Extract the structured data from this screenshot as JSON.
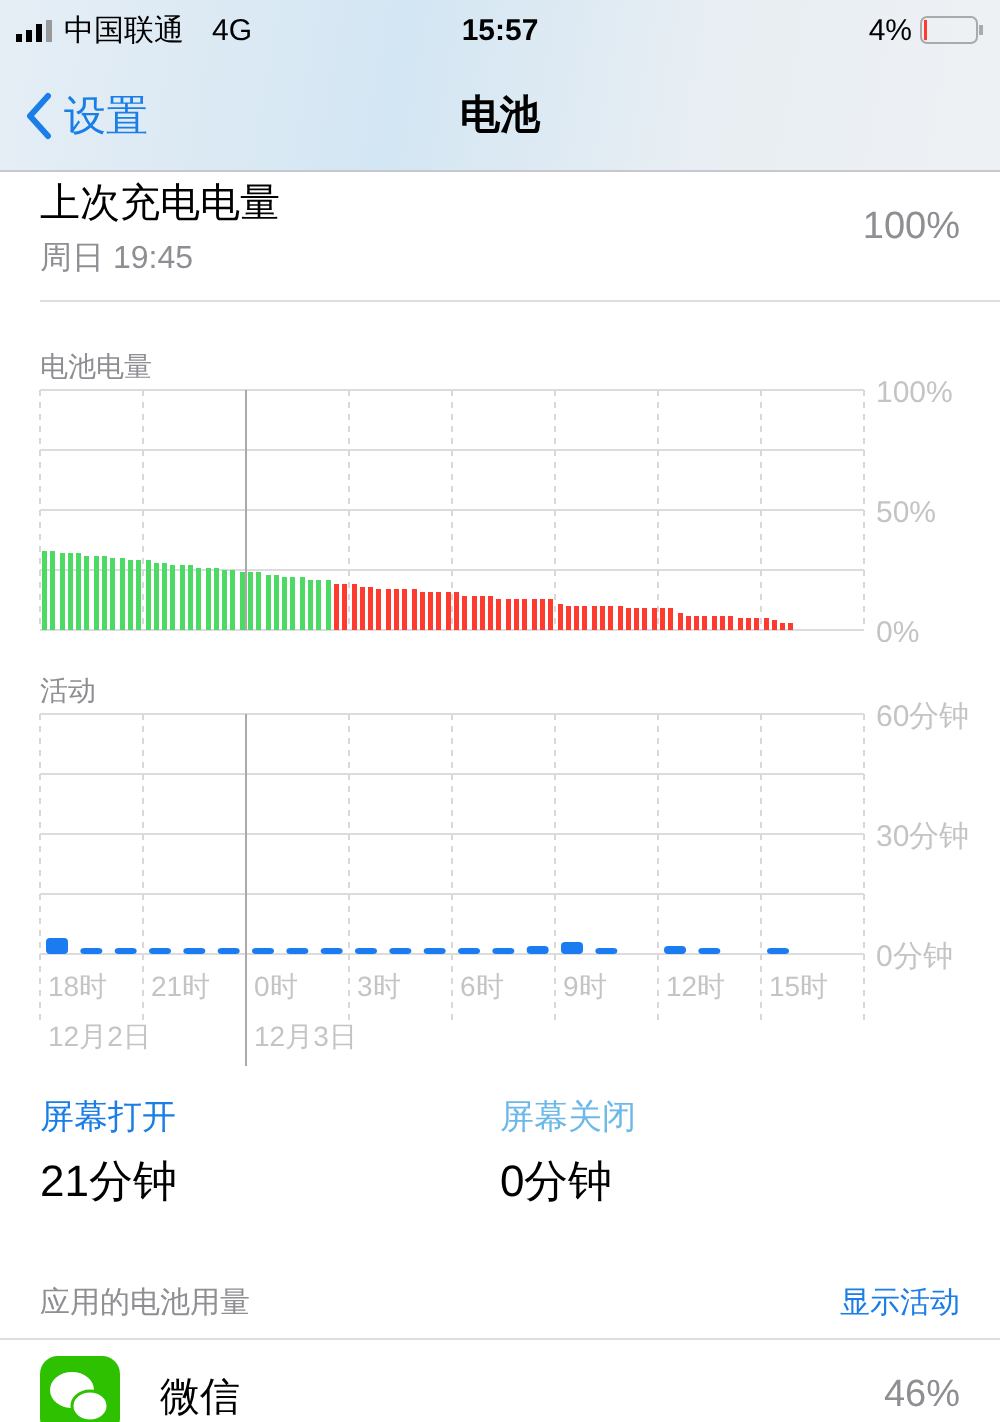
{
  "status_bar": {
    "carrier": "中国联通",
    "network": "4G",
    "time": "15:57",
    "battery_percent": "4%"
  },
  "nav": {
    "back": "设置",
    "title": "电池"
  },
  "last_charge": {
    "label": "上次充电电量",
    "time": "周日 19:45",
    "value": "100%"
  },
  "battery_chart": {
    "title": "电池电量",
    "chart_data": {
      "type": "bar",
      "ylim": [
        0,
        100
      ],
      "yticks": [
        {
          "value": 100,
          "label": "100%"
        },
        {
          "value": 50,
          "label": "50%"
        },
        {
          "value": 0,
          "label": "0%"
        }
      ],
      "series": [
        {
          "color": "#4cd964",
          "values": [
            33,
            33,
            32,
            32,
            32,
            31,
            31,
            31,
            30,
            30,
            29,
            29,
            29,
            28,
            28,
            27,
            27,
            27,
            26,
            26,
            26,
            25,
            25,
            24,
            24,
            24,
            23,
            23,
            22,
            22,
            22,
            21,
            21,
            21,
            null,
            null,
            null,
            null,
            null,
            null,
            null,
            null,
            null,
            null,
            null,
            null,
            null,
            null,
            null,
            null,
            null,
            null,
            null,
            null,
            null,
            null,
            null,
            null,
            null,
            null,
            null,
            null,
            null,
            null,
            null,
            null,
            null,
            null,
            null,
            null,
            null,
            null,
            null,
            null,
            null,
            null,
            null,
            null,
            null,
            null,
            null,
            null,
            null,
            null,
            null,
            null,
            null,
            null,
            null,
            null,
            null,
            null,
            null,
            null,
            null,
            null
          ]
        },
        {
          "color": "#ff3b30",
          "values": [
            null,
            null,
            null,
            null,
            null,
            null,
            null,
            null,
            null,
            null,
            null,
            null,
            null,
            null,
            null,
            null,
            null,
            null,
            null,
            null,
            null,
            null,
            null,
            null,
            null,
            null,
            null,
            null,
            null,
            null,
            null,
            null,
            null,
            null,
            19,
            19,
            19,
            18,
            18,
            17,
            17,
            17,
            17,
            17,
            16,
            16,
            16,
            16,
            16,
            14,
            14,
            14,
            14,
            13,
            13,
            13,
            13,
            13,
            13,
            13,
            11,
            10,
            10,
            10,
            10,
            10,
            10,
            10,
            9,
            9,
            9,
            9,
            9,
            9,
            7,
            6,
            6,
            6,
            6,
            6,
            6,
            5,
            5,
            5,
            5,
            4,
            3,
            3,
            null,
            null,
            null,
            null,
            null,
            null,
            null,
            null
          ]
        }
      ]
    }
  },
  "activity_chart": {
    "title": "活动",
    "hour_labels": [
      "18时",
      "21时",
      "0时",
      "3时",
      "6时",
      "9时",
      "12时",
      "15时"
    ],
    "date_labels": [
      "12月2日",
      "12月3日"
    ],
    "chart_data": {
      "type": "bar",
      "ylim": [
        0,
        60
      ],
      "yticks": [
        {
          "value": 60,
          "label": "60分钟"
        },
        {
          "value": 30,
          "label": "30分钟"
        },
        {
          "value": 0,
          "label": "0分钟"
        }
      ],
      "series": [
        {
          "color": "#1a7cf0",
          "values": [
            4,
            1,
            1,
            1,
            1,
            1,
            1,
            1,
            1,
            1,
            1,
            1,
            1,
            1,
            2,
            3,
            1,
            null,
            2,
            1,
            null,
            1,
            null,
            null
          ]
        }
      ]
    }
  },
  "screen": [
    {
      "label": "屏幕打开",
      "value": "21分钟",
      "color": "#1a7ee6"
    },
    {
      "label": "屏幕关闭",
      "value": "0分钟",
      "color": "#6cb8e8"
    }
  ],
  "usage": {
    "title": "应用的电池用量",
    "action": "显示活动",
    "apps": [
      {
        "name": "微信",
        "percent": "46%"
      }
    ]
  }
}
